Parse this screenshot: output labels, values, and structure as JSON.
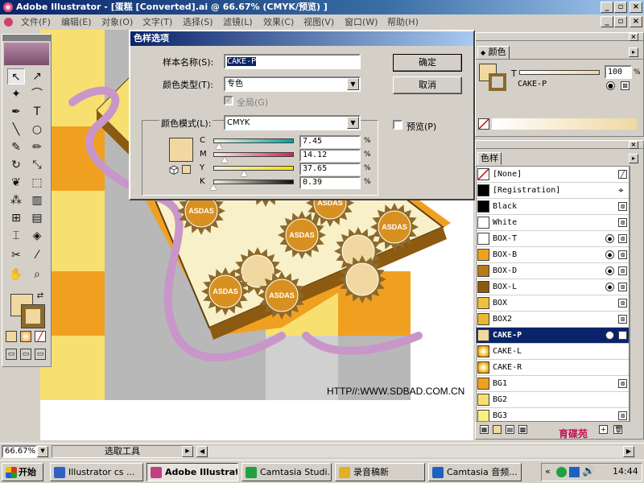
{
  "window": {
    "title": "Adobe Illustrator - [蛋糕 [Converted].ai @ 66.67% (CMYK/预览) ]",
    "minimize": "_",
    "maximize": "▫",
    "close": "×"
  },
  "menu": [
    "文件(F)",
    "编辑(E)",
    "对象(O)",
    "文字(T)",
    "选择(S)",
    "滤镜(L)",
    "效果(C)",
    "视图(V)",
    "窗口(W)",
    "帮助(H)"
  ],
  "canvas": {
    "url_text": "HTTP//:WWW.SDBAD.COM.CN",
    "sun_label": "ASDAS"
  },
  "dialog": {
    "title": "色样选项",
    "swatch_name_label": "样本名称(S):",
    "swatch_name_value": "CAKE-P",
    "color_type_label": "颜色类型(T):",
    "color_type_value": "专色",
    "global_label": "全局(G)",
    "color_mode_label": "颜色模式(L):",
    "color_mode_value": "CMYK",
    "preview_label": "预览(P)",
    "ok": "确定",
    "cancel": "取消",
    "percent_sign": "%",
    "sliders": [
      {
        "channel": "C",
        "value": "7.45",
        "fraction": 0.0745,
        "color_start": "#f0f0e0",
        "color_end": "#00a0a8"
      },
      {
        "channel": "M",
        "value": "14.12",
        "fraction": 0.1412,
        "color_start": "#f0f0e0",
        "color_end": "#d8205a"
      },
      {
        "channel": "Y",
        "value": "37.65",
        "fraction": 0.3765,
        "color_start": "#f0f0e0",
        "color_end": "#f8e000"
      },
      {
        "channel": "K",
        "value": "0.39",
        "fraction": 0.0039,
        "color_start": "#f0f0e0",
        "color_end": "#101010"
      }
    ],
    "preview_color": "#f0d8a0"
  },
  "color_panel": {
    "tab": "颜色",
    "tint_label": "T",
    "tint_value": "100",
    "percent_sign": "%",
    "swatch_name": "CAKE-P",
    "color": "#f0d8a0"
  },
  "swatches_panel": {
    "tab": "色样",
    "items": [
      {
        "name": "[None]",
        "color": "#ffffff",
        "kind": "none"
      },
      {
        "name": "[Registration]",
        "color": "#000000",
        "kind": "reg"
      },
      {
        "name": "Black",
        "color": "#000000",
        "kind": "process"
      },
      {
        "name": "White",
        "color": "#ffffff",
        "kind": "process"
      },
      {
        "name": "BOX-T",
        "color": "#ffffff",
        "kind": "spot"
      },
      {
        "name": "BOX-B",
        "color": "#f0a020",
        "kind": "spot"
      },
      {
        "name": "BOX-D",
        "color": "#b87818",
        "kind": "spot"
      },
      {
        "name": "BOX-L",
        "color": "#8c5a10",
        "kind": "spot"
      },
      {
        "name": "BOX",
        "color": "#f0c040",
        "kind": "process"
      },
      {
        "name": "BOX2",
        "color": "#e8b830",
        "kind": "process"
      },
      {
        "name": "CAKE-P",
        "color": "#f0d8a0",
        "kind": "spot",
        "selected": true
      },
      {
        "name": "CAKE-L",
        "color": "#f8c020",
        "kind": "gradient"
      },
      {
        "name": "CAKE-R",
        "color": "#f8c020",
        "kind": "gradient"
      },
      {
        "name": "BG1",
        "color": "#f0a020",
        "kind": "process"
      },
      {
        "name": "BG2",
        "color": "#f8e070",
        "kind": "none2"
      },
      {
        "name": "BG3",
        "color": "#f8f080",
        "kind": "process"
      }
    ]
  },
  "statusbar": {
    "zoom": "66.67%",
    "tool": "选取工具"
  },
  "taskbar": {
    "start": "开始",
    "tasks": [
      {
        "label": "Illustrator cs ...",
        "color": "#3060c0",
        "active": false
      },
      {
        "label": "Adobe Illustrat...",
        "color": "#c04080",
        "active": true
      },
      {
        "label": "Camtasia Studi...",
        "color": "#20a040",
        "active": false
      },
      {
        "label": "录音稿新",
        "color": "#e0b020",
        "active": false
      },
      {
        "label": "Camtasia 音频...",
        "color": "#2060c0",
        "active": false
      }
    ],
    "clock": "14:44",
    "tray_overflow": "«"
  },
  "watermark": {
    "text": "育碟苑"
  }
}
